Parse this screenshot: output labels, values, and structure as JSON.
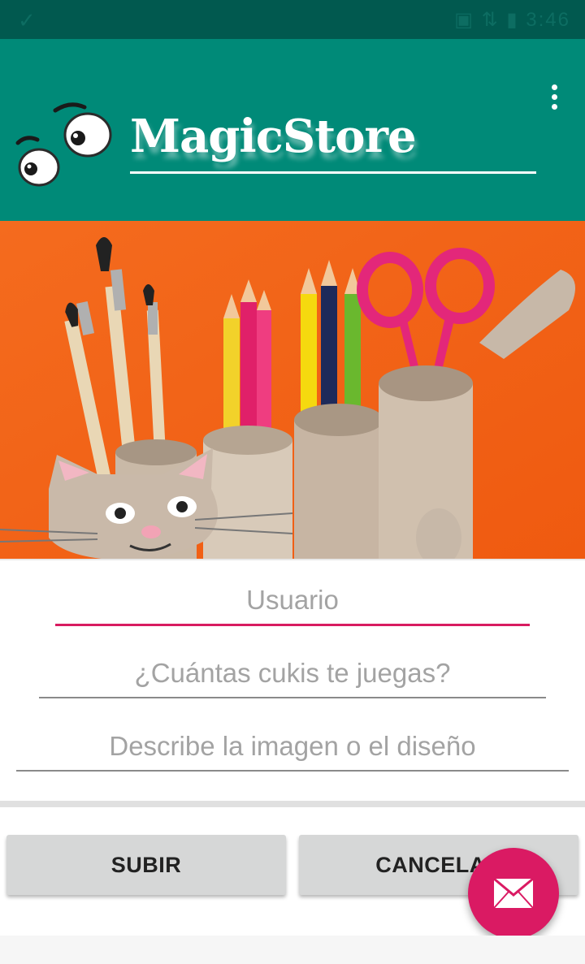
{
  "status_bar": {
    "left_icon": "✓",
    "right_text": "▣ ⇅ ▮ 3:46"
  },
  "app_bar": {
    "title": "MagicStore",
    "background_color": "#008a78"
  },
  "icons": {
    "menu": "more-vert-icon",
    "logo": "eyes-logo",
    "fab": "email-icon"
  },
  "form": {
    "username_placeholder": "Usuario",
    "amount_placeholder": "¿Cuántas cukis te juegas?",
    "description_placeholder": "Describe la imagen o el diseño"
  },
  "buttons": {
    "upload_label": "SUBIR",
    "cancel_label": "CANCELAR"
  },
  "colors": {
    "accent": "#da1a63",
    "primary": "#008a78",
    "primary_dark": "#01594f"
  }
}
